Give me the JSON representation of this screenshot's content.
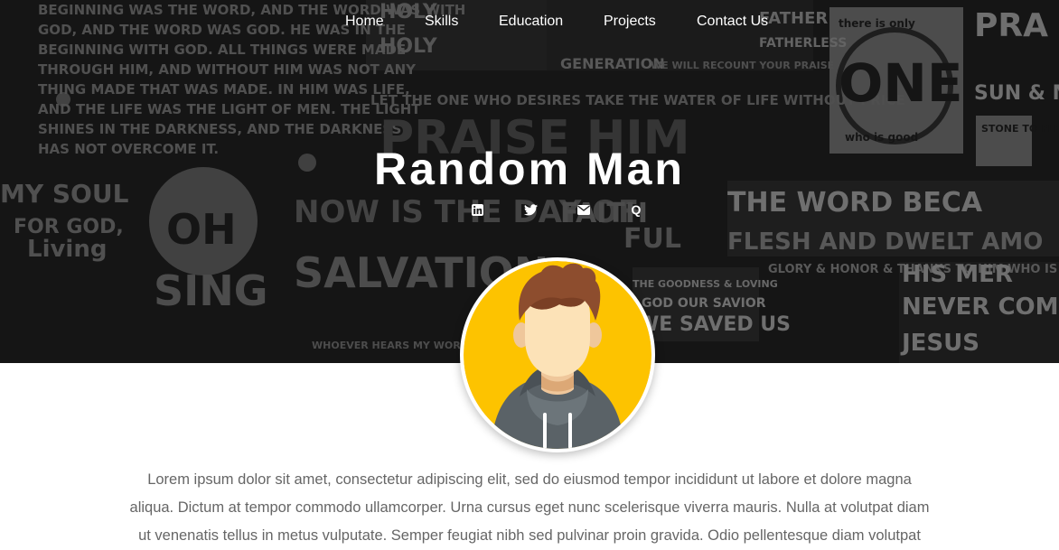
{
  "nav": {
    "items": [
      {
        "label": "Home"
      },
      {
        "label": "Skills"
      },
      {
        "label": "Education"
      },
      {
        "label": "Projects"
      },
      {
        "label": "Contact Us"
      }
    ]
  },
  "profile": {
    "name": "Random Man",
    "social": [
      {
        "icon": "linkedin-icon"
      },
      {
        "icon": "twitter-icon"
      },
      {
        "icon": "envelope-icon"
      },
      {
        "icon": "quora-icon",
        "label": "Q"
      }
    ],
    "bio": "Lorem ipsum dolor sit amet, consectetur adipiscing elit, sed do eiusmod tempor incididunt ut labore et dolore magna aliqua. Dictum at tempor commodo ullamcorper. Urna cursus eget nunc scelerisque viverra mauris. Nulla at volutpat diam ut venenatis tellus in metus vulputate. Semper feugiat nibh sed pulvinar proin gravida. Odio pellentesque diam volutpat"
  },
  "hero_background": {
    "words": [
      "BEGINNING WAS THE WORD, AND THE WORD WAS WITH",
      "GOD, AND THE WORD WAS GOD. HE WAS IN THE",
      "BEGINNING WITH GOD. ALL THINGS WERE MADE",
      "THROUGH HIM, AND WITHOUT HIM WAS NOT ANY",
      "THING MADE THAT WAS MADE. IN HIM WAS LIFE,",
      "AND THE LIFE WAS THE LIGHT OF MEN. THE LIGHT",
      "SHINES IN THE DARKNESS, AND THE DARKNESS",
      "HAS NOT OVERCOME IT.",
      "HOLY",
      "HOLY",
      "GENERATION",
      "WE WILL RECOUNT YOUR PRAISE",
      "LET THE ONE WHO DESIRES TAKE THE WATER OF LIFE WITHOUT PRICE",
      "PRAISE HIM",
      "NOW IS THE DAY OF",
      "SALVATION",
      "FAITH",
      "FUL",
      "THE WORD BECA",
      "FLESH AND DWELT AMO",
      "MY SOUL",
      "FOR GOD,",
      "Living",
      "OH",
      "SING",
      "THE GOODNESS & LOVING",
      "GOD OUR SAVIOR",
      "WE SAVED US",
      "GLORY & HONOR & THANKS TO HIM WHO IS SEATED ON THE THRONE",
      "HIS MER",
      "NEVER COME TO",
      "JESUS",
      "there is only",
      "ONE",
      "who is good",
      "STONE TO FLESH",
      "PRA",
      "SUN & M",
      "FATHER",
      "FATHERLESS",
      "WHOEVER HEARS MY WORD"
    ]
  }
}
